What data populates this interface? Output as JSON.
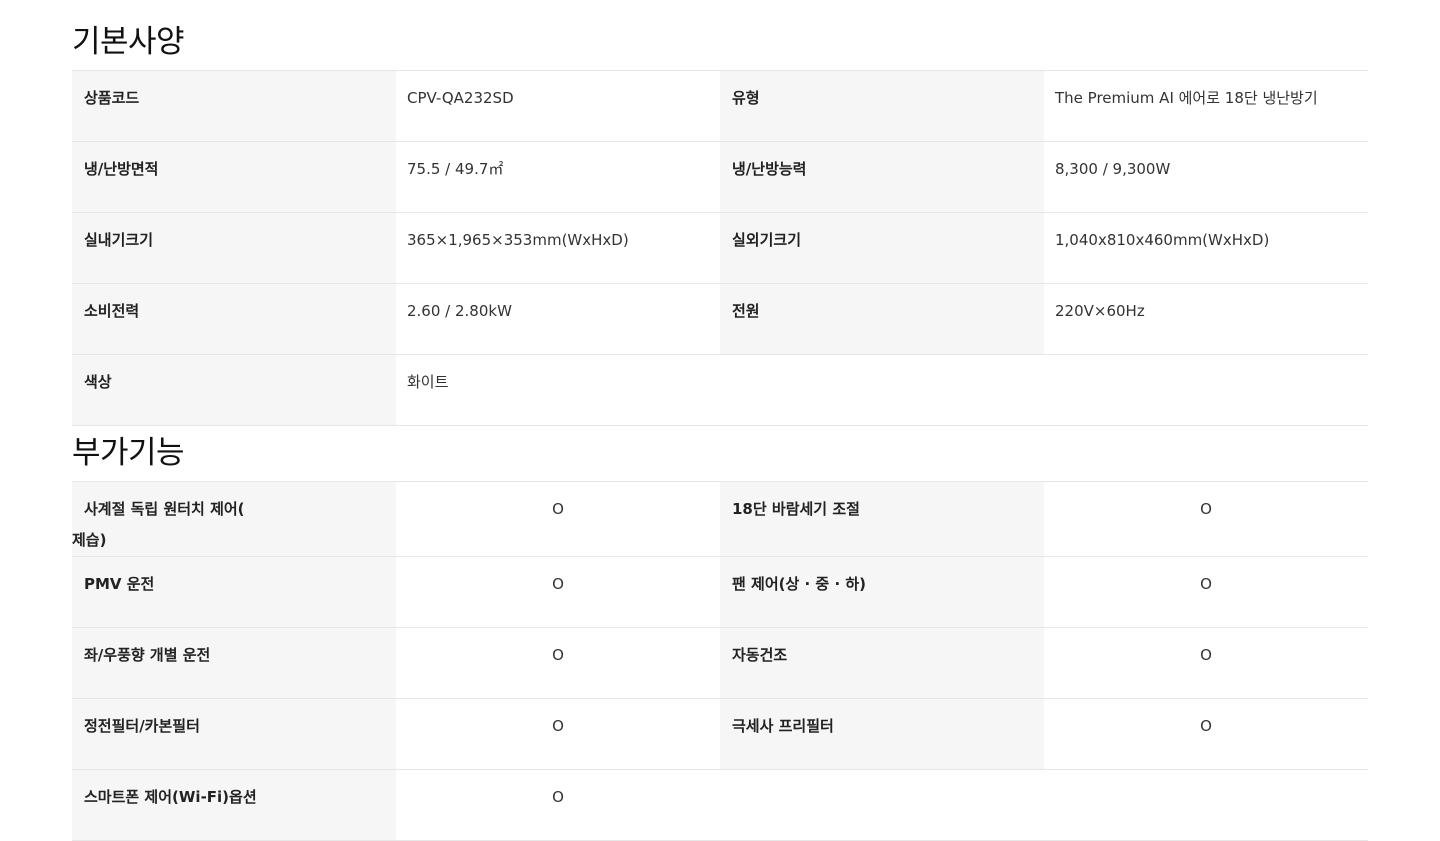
{
  "sections": {
    "basic": {
      "title": "기본사양",
      "rows": [
        [
          {
            "label": "상품코드",
            "value": "CPV-QA232SD"
          },
          {
            "label": "유형",
            "value": "The Premium AI 에어로 18단 냉난방기"
          }
        ],
        [
          {
            "label": "냉/난방면적",
            "value": "75.5 / 49.7㎡"
          },
          {
            "label": "냉/난방능력",
            "value": "8,300 / 9,300W"
          }
        ],
        [
          {
            "label": "실내기크기",
            "value": "365×1,965×353mm(WxHxD)"
          },
          {
            "label": "실외기크기",
            "value": "1,040x810x460mm(WxHxD)"
          }
        ],
        [
          {
            "label": "소비전력",
            "value": "2.60 / 2.80kW"
          },
          {
            "label": "전원",
            "value": "220V×60Hz"
          }
        ],
        [
          {
            "label": "색상",
            "value": "화이트"
          }
        ]
      ]
    },
    "extra": {
      "title": "부가기능",
      "rows": [
        [
          {
            "label_line1": "사계절 독립 원터치 제어(",
            "label_line2": "제습)",
            "value": "O"
          },
          {
            "label": "18단 바람세기 조절",
            "value": "O"
          }
        ],
        [
          {
            "label": "PMV 운전",
            "value": "O"
          },
          {
            "label": "팬 제어(상 · 중 · 하)",
            "value": "O"
          }
        ],
        [
          {
            "label": "좌/우풍향 개별 운전",
            "value": "O"
          },
          {
            "label": "자동건조",
            "value": "O"
          }
        ],
        [
          {
            "label": "정전필터/카본필터",
            "value": "O"
          },
          {
            "label": "극세사 프리필터",
            "value": "O"
          }
        ],
        [
          {
            "label": "스마트폰 제어(Wi-Fi)옵션",
            "value": "O"
          }
        ]
      ]
    }
  }
}
